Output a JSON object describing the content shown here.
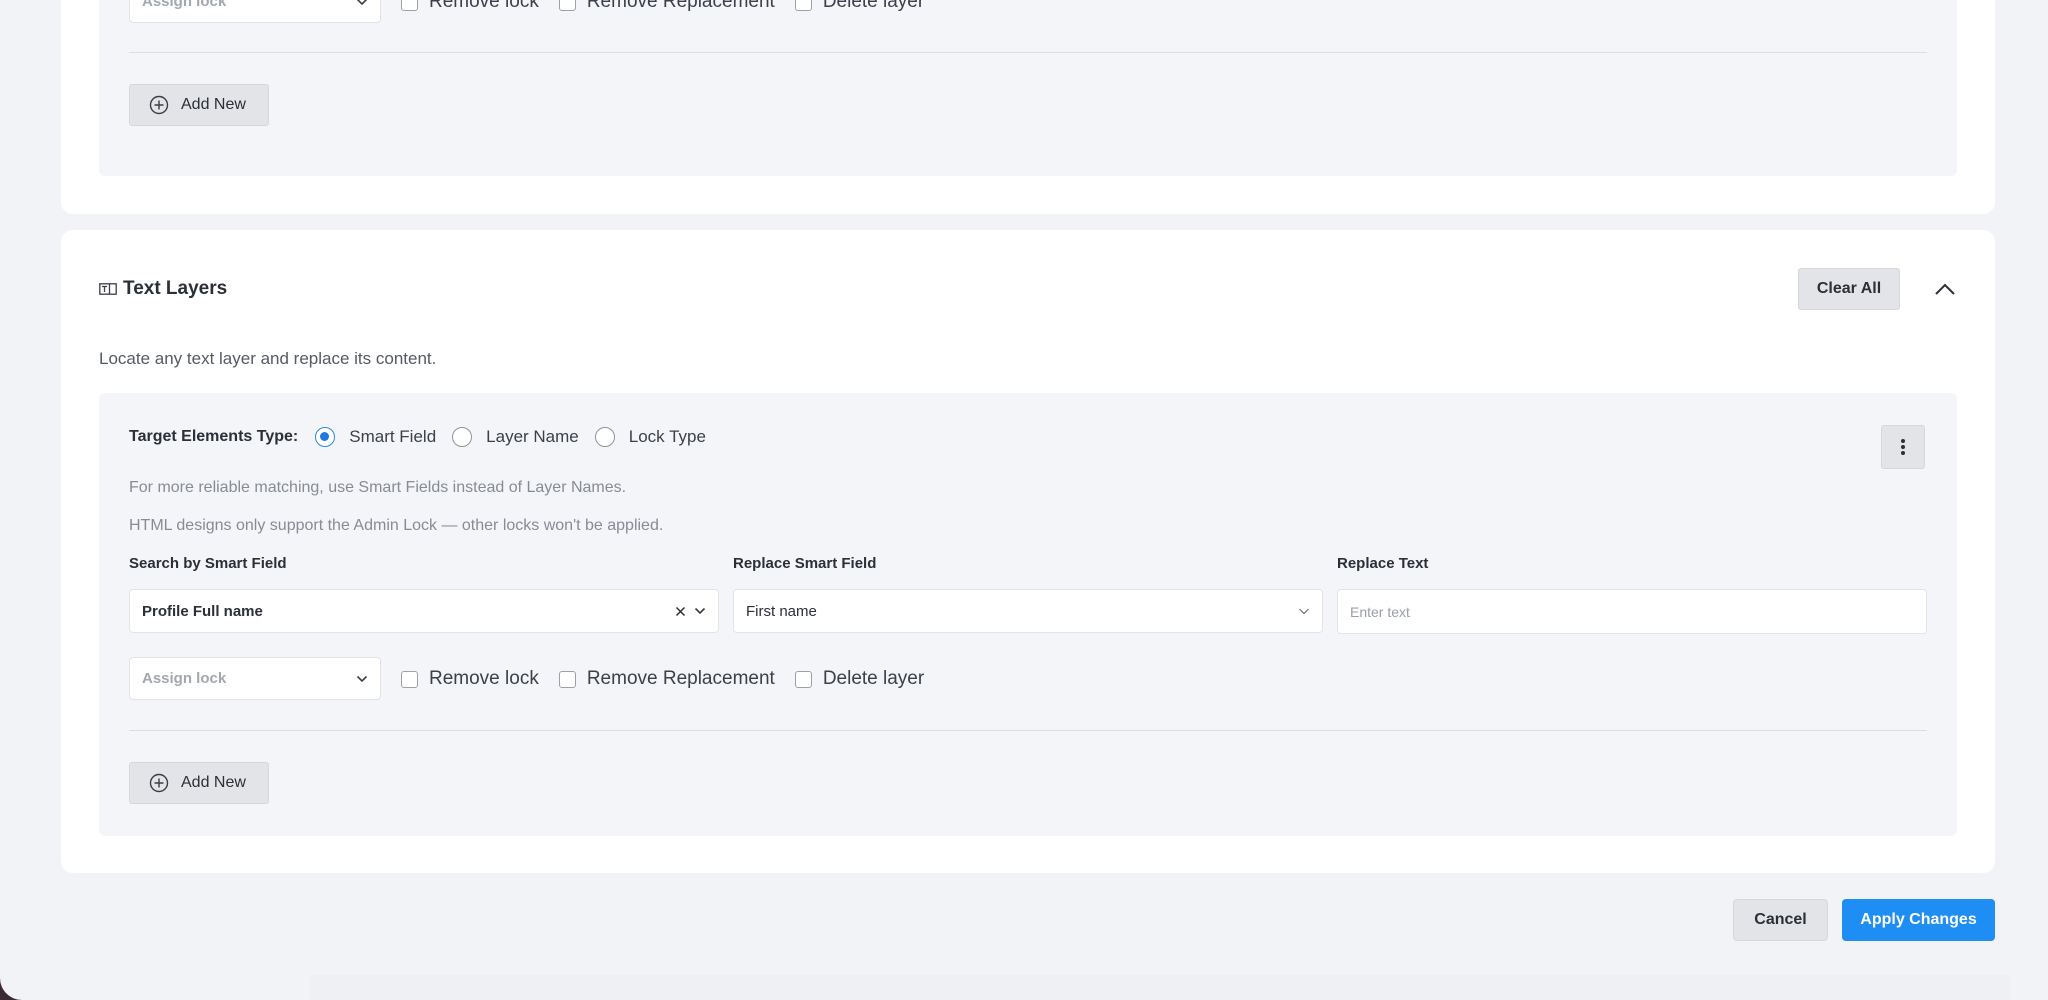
{
  "top_section": {
    "assign_lock_placeholder": "Assign lock",
    "checkboxes": [
      "Remove lock",
      "Remove Replacement",
      "Delete layer"
    ],
    "add_new_label": "Add New"
  },
  "text_layers": {
    "title": "Text Layers",
    "description": "Locate any text layer and replace its content.",
    "clear_all_label": "Clear All",
    "target_label": "Target Elements Type:",
    "target_options": [
      {
        "label": "Smart Field",
        "selected": true
      },
      {
        "label": "Layer Name",
        "selected": false
      },
      {
        "label": "Lock Type",
        "selected": false
      }
    ],
    "hint_1": "For more reliable matching, use Smart Fields instead of Layer Names.",
    "hint_2": "HTML designs only support the Admin Lock — other locks won't be applied.",
    "search_label": "Search by Smart Field",
    "search_value": "Profile Full name",
    "replace_smart_label": "Replace Smart Field",
    "replace_smart_value": "First name",
    "replace_text_label": "Replace Text",
    "replace_text_placeholder": "Enter text",
    "assign_lock_placeholder": "Assign lock",
    "checkboxes": [
      "Remove lock",
      "Remove Replacement",
      "Delete layer"
    ],
    "add_new_label": "Add New"
  },
  "footer": {
    "cancel_label": "Cancel",
    "apply_label": "Apply Changes"
  },
  "colors": {
    "primary": "#1e8ef5",
    "radio_selected": "#1f7ae0",
    "page_bg": "#f2f3f7",
    "card_bg": "#ffffff"
  }
}
